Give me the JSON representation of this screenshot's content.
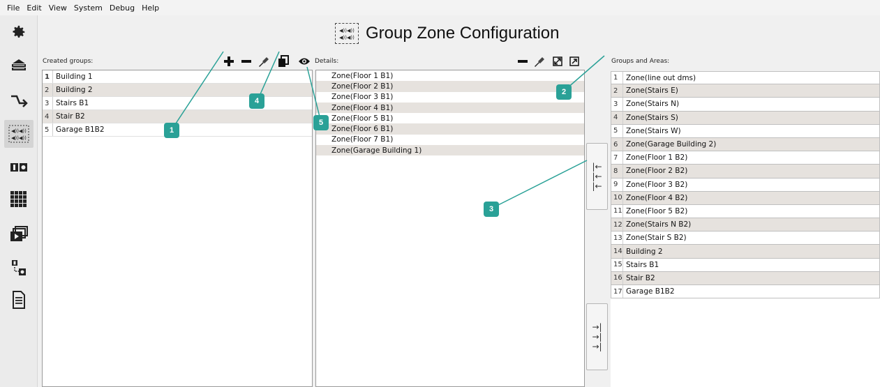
{
  "menu": [
    "File",
    "Edit",
    "View",
    "System",
    "Debug",
    "Help"
  ],
  "sidebar": {
    "items": [
      {
        "icon": "gear-icon"
      },
      {
        "icon": "server-icon"
      },
      {
        "icon": "route-arrow-icon"
      },
      {
        "icon": "speaker-group-icon",
        "active": true
      },
      {
        "icon": "io-module-icon"
      },
      {
        "icon": "grid-matrix-icon"
      },
      {
        "icon": "media-player-icon"
      },
      {
        "icon": "device-link-icon"
      },
      {
        "icon": "document-icon"
      }
    ]
  },
  "header": {
    "title": "Group Zone Configuration"
  },
  "created": {
    "label": "Created groups:",
    "rows": [
      {
        "num": "1",
        "name": "Building 1"
      },
      {
        "num": "2",
        "name": "Building 2"
      },
      {
        "num": "3",
        "name": "Stairs B1"
      },
      {
        "num": "4",
        "name": "Stair B2"
      },
      {
        "num": "5",
        "name": "Garage B1B2"
      }
    ]
  },
  "details": {
    "label": "Details:",
    "rows": [
      "Zone(Floor 1 B1)",
      "Zone(Floor 2 B1)",
      "Zone(Floor 3 B1)",
      "Zone(Floor 4 B1)",
      "Zone(Floor 5 B1)",
      "Zone(Floor 6 B1)",
      "Zone(Floor 7 B1)",
      "Zone(Garage Building 1)"
    ]
  },
  "groups": {
    "label": "Groups and Areas:",
    "rows": [
      {
        "num": "1",
        "name": "Zone(line out dms)"
      },
      {
        "num": "2",
        "name": "Zone(Stairs E)"
      },
      {
        "num": "3",
        "name": "Zone(Stairs N)"
      },
      {
        "num": "4",
        "name": "Zone(Stairs S)"
      },
      {
        "num": "5",
        "name": "Zone(Stairs W)"
      },
      {
        "num": "6",
        "name": "Zone(Garage Building 2)"
      },
      {
        "num": "7",
        "name": "Zone(Floor 1 B2)"
      },
      {
        "num": "8",
        "name": "Zone(Floor 2 B2)"
      },
      {
        "num": "9",
        "name": "Zone(Floor 3 B2)"
      },
      {
        "num": "10",
        "name": "Zone(Floor 4 B2)"
      },
      {
        "num": "11",
        "name": "Zone(Floor 5 B2)"
      },
      {
        "num": "12",
        "name": "Zone(Stairs N B2)"
      },
      {
        "num": "13",
        "name": "Zone(Stair S B2)"
      },
      {
        "num": "14",
        "name": "Building 2"
      },
      {
        "num": "15",
        "name": "Stairs B1"
      },
      {
        "num": "16",
        "name": "Stair B2"
      },
      {
        "num": "17",
        "name": "Garage B1B2"
      }
    ]
  },
  "move_buttons": {
    "add_glyph": "|←",
    "remove_glyph": "→|"
  },
  "callouts": [
    "1",
    "2",
    "3",
    "4",
    "5"
  ],
  "colors": {
    "callout": "#2aa197",
    "row_alt": "#e6e2de"
  }
}
